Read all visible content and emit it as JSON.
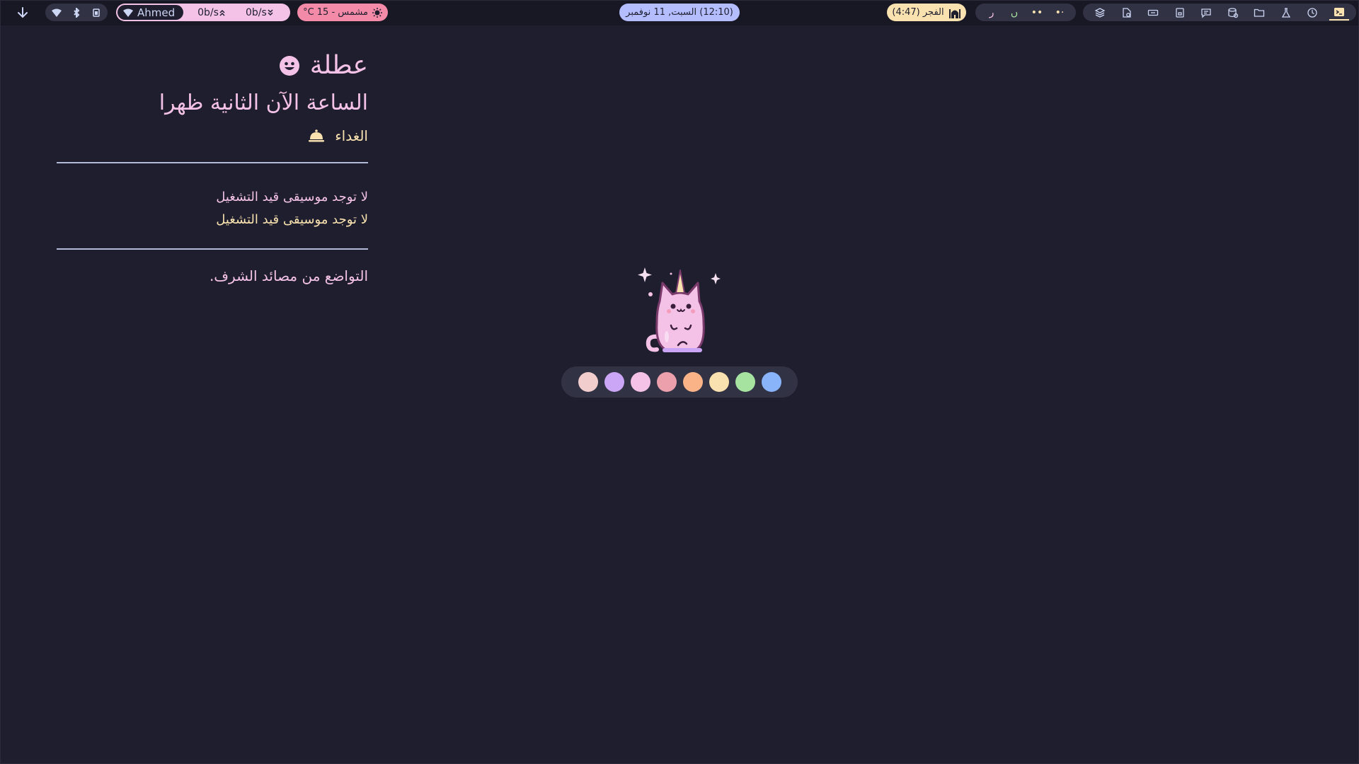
{
  "top_bar": {
    "arrow_icon": "arrow-down-icon",
    "system": {
      "icons": [
        "wifi-icon",
        "bluetooth-icon",
        "battery-icon"
      ]
    },
    "network": {
      "user": "Ahmed",
      "upload": "0b/s",
      "download": "0b/s",
      "accent": "#f5c2e7"
    },
    "weather": {
      "text": "مشمس - 15 C°",
      "icon": "sun-icon",
      "accent": "#f38ba8"
    },
    "clock": {
      "text": "(12:10) السبت, 11 نوفمبر",
      "accent": "#b4befe"
    },
    "prayer": {
      "text": "الفجر (4:47)",
      "icon": "mosque-icon",
      "accent": "#f9e2af"
    },
    "workspaces": [
      "ر",
      "ں",
      "••",
      "•·"
    ],
    "tray_icons": [
      "layers-icon",
      "document-icon",
      "ticket-icon",
      "file-icon",
      "chat-icon",
      "database-icon",
      "folder-icon",
      "flask-icon",
      "clock-icon",
      "terminal-icon"
    ]
  },
  "panel": {
    "greeting": "عطلة",
    "time_text": "الساعة الآن الثانية ظهرا",
    "meal": "الغداء",
    "music_line_1": "لا توجد موسيقى قيد التشغيل",
    "music_line_2": "لا توجد موسيقى قيد التشغيل",
    "quote": "التواضع من مصائد الشرف."
  },
  "palette": {
    "colors": [
      "#f2cdcd",
      "#cba6f7",
      "#f5c2e7",
      "#eba0ac",
      "#fab387",
      "#f9e2af",
      "#a6e3a1",
      "#89b4fa"
    ]
  },
  "colors": {
    "background": "#1e1e2e",
    "text_pink": "#f5c2e7",
    "text_yellow": "#f9e2af"
  }
}
